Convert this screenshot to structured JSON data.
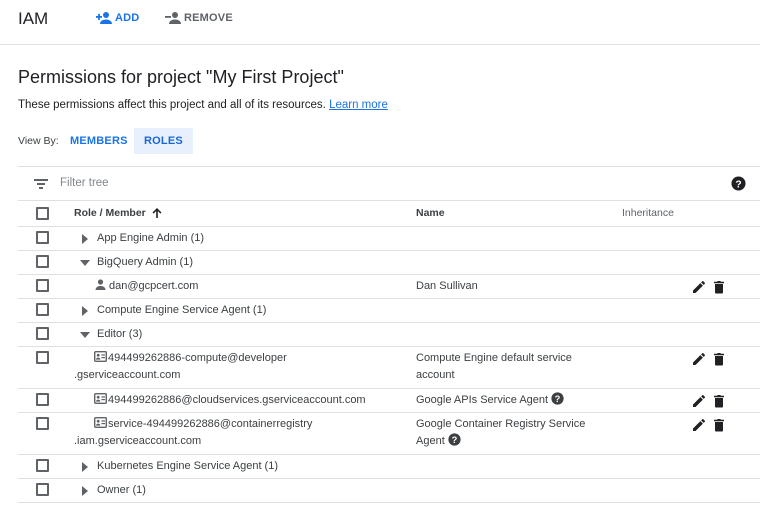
{
  "header": {
    "app_title": "IAM",
    "add_label": "ADD",
    "remove_label": "REMOVE"
  },
  "page": {
    "title": "Permissions for project \"My First Project\"",
    "description": "These permissions affect this project and all of its resources.",
    "learn_more": "Learn more"
  },
  "view_by": {
    "label": "View By:",
    "tabs": [
      {
        "label": "MEMBERS",
        "selected": false
      },
      {
        "label": "ROLES",
        "selected": true
      }
    ]
  },
  "filter": {
    "placeholder": "Filter tree",
    "icon": "filter-list-icon",
    "help_icon": "help-icon"
  },
  "table": {
    "columns": {
      "role_member": "Role / Member",
      "name": "Name",
      "inheritance": "Inheritance"
    },
    "sort": "ascending",
    "rows": [
      {
        "type": "role",
        "label": "App Engine Admin (1)",
        "expanded": false
      },
      {
        "type": "role",
        "label": "BigQuery Admin (1)",
        "expanded": true
      },
      {
        "type": "member",
        "icon": "person-icon",
        "member": "dan@gcpcert.com",
        "name": "Dan Sullivan"
      },
      {
        "type": "role",
        "label": "Compute Engine Service Agent (1)",
        "expanded": false
      },
      {
        "type": "role",
        "label": "Editor (3)",
        "expanded": true
      },
      {
        "type": "member",
        "icon": "service-account-icon",
        "member_line1": "494499262886-compute@developer",
        "member_line2": ".gserviceaccount.com",
        "name_line1": "Compute Engine default service",
        "name_line2": "account"
      },
      {
        "type": "member",
        "icon": "service-account-icon",
        "member": "494499262886@cloudservices.gserviceaccount.com",
        "name": "Google APIs Service Agent"
      },
      {
        "type": "member",
        "icon": "service-account-icon",
        "member_line1": "service-494499262886@containerregistry",
        "member_line2": ".iam.gserviceaccount.com",
        "name_line1": "Google Container Registry Service",
        "name_line2": "Agent"
      },
      {
        "type": "role",
        "label": "Kubernetes Engine Service Agent (1)",
        "expanded": false
      },
      {
        "type": "role",
        "label": "Owner (1)",
        "expanded": false
      }
    ]
  },
  "colors": {
    "accent": "#1a73e8",
    "selected_tab_bg": "#e8f0fe",
    "divider": "#e0e0e0"
  }
}
